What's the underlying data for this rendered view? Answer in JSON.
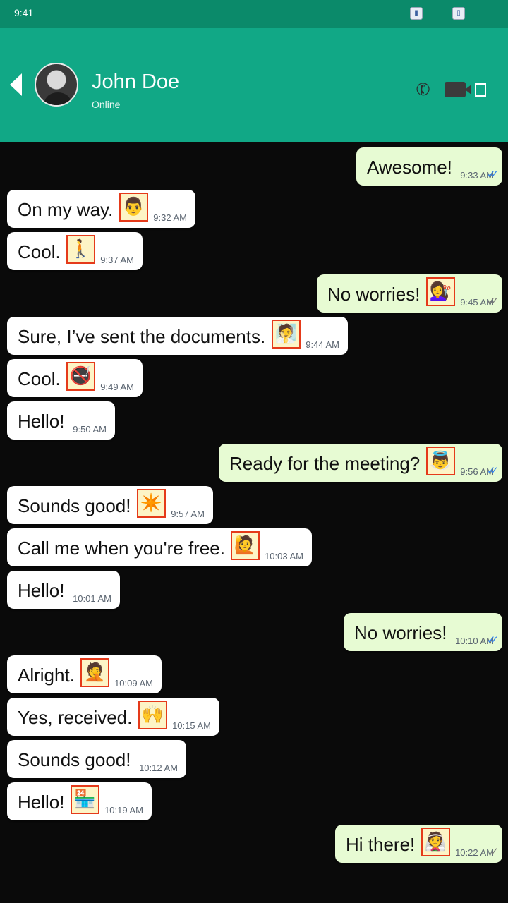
{
  "status_bar": {
    "time": "9:41"
  },
  "header": {
    "contact_name": "John Doe",
    "contact_status": "Online"
  },
  "messages": [
    {
      "dir": "out",
      "text": "Awesome!",
      "emoji": "",
      "time": "9:33 AM",
      "ticks": "read"
    },
    {
      "dir": "in",
      "text": "On my way.",
      "emoji": "👨",
      "time": "9:32 AM"
    },
    {
      "dir": "in",
      "text": "Cool.",
      "emoji": "🚶➡️",
      "time": "9:37 AM"
    },
    {
      "dir": "out",
      "text": "No worries!",
      "emoji": "💇‍♀️",
      "time": "9:45 AM",
      "ticks": "grey"
    },
    {
      "dir": "in",
      "text": "Sure, I’ve sent the documents.",
      "emoji": "🧖",
      "time": "9:44 AM"
    },
    {
      "dir": "in",
      "text": "Cool.",
      "emoji": "🚭",
      "time": "9:49 AM"
    },
    {
      "dir": "in",
      "text": "Hello!",
      "emoji": "",
      "time": "9:50 AM"
    },
    {
      "dir": "out",
      "text": "Ready for the meeting?",
      "emoji": "👼",
      "time": "9:56 AM",
      "ticks": "read"
    },
    {
      "dir": "in",
      "text": "Sounds good!",
      "emoji": "✴️",
      "time": "9:57 AM"
    },
    {
      "dir": "in",
      "text": "Call me when you're free.",
      "emoji": "🙋",
      "time": "10:03 AM"
    },
    {
      "dir": "in",
      "text": "Hello!",
      "emoji": "",
      "time": "10:01 AM"
    },
    {
      "dir": "out",
      "text": "No worries!",
      "emoji": "",
      "time": "10:10 AM",
      "ticks": "read"
    },
    {
      "dir": "in",
      "text": "Alright.",
      "emoji": "🤦",
      "time": "10:09 AM"
    },
    {
      "dir": "in",
      "text": "Yes, received.",
      "emoji": "🙌",
      "time": "10:15 AM"
    },
    {
      "dir": "in",
      "text": "Sounds good!",
      "emoji": "",
      "time": "10:12 AM"
    },
    {
      "dir": "in",
      "text": "Hello!",
      "emoji": "🏪",
      "time": "10:19 AM"
    },
    {
      "dir": "out",
      "text": "Hi there!",
      "emoji": "👰",
      "time": "10:22 AM",
      "ticks": "sent"
    }
  ]
}
